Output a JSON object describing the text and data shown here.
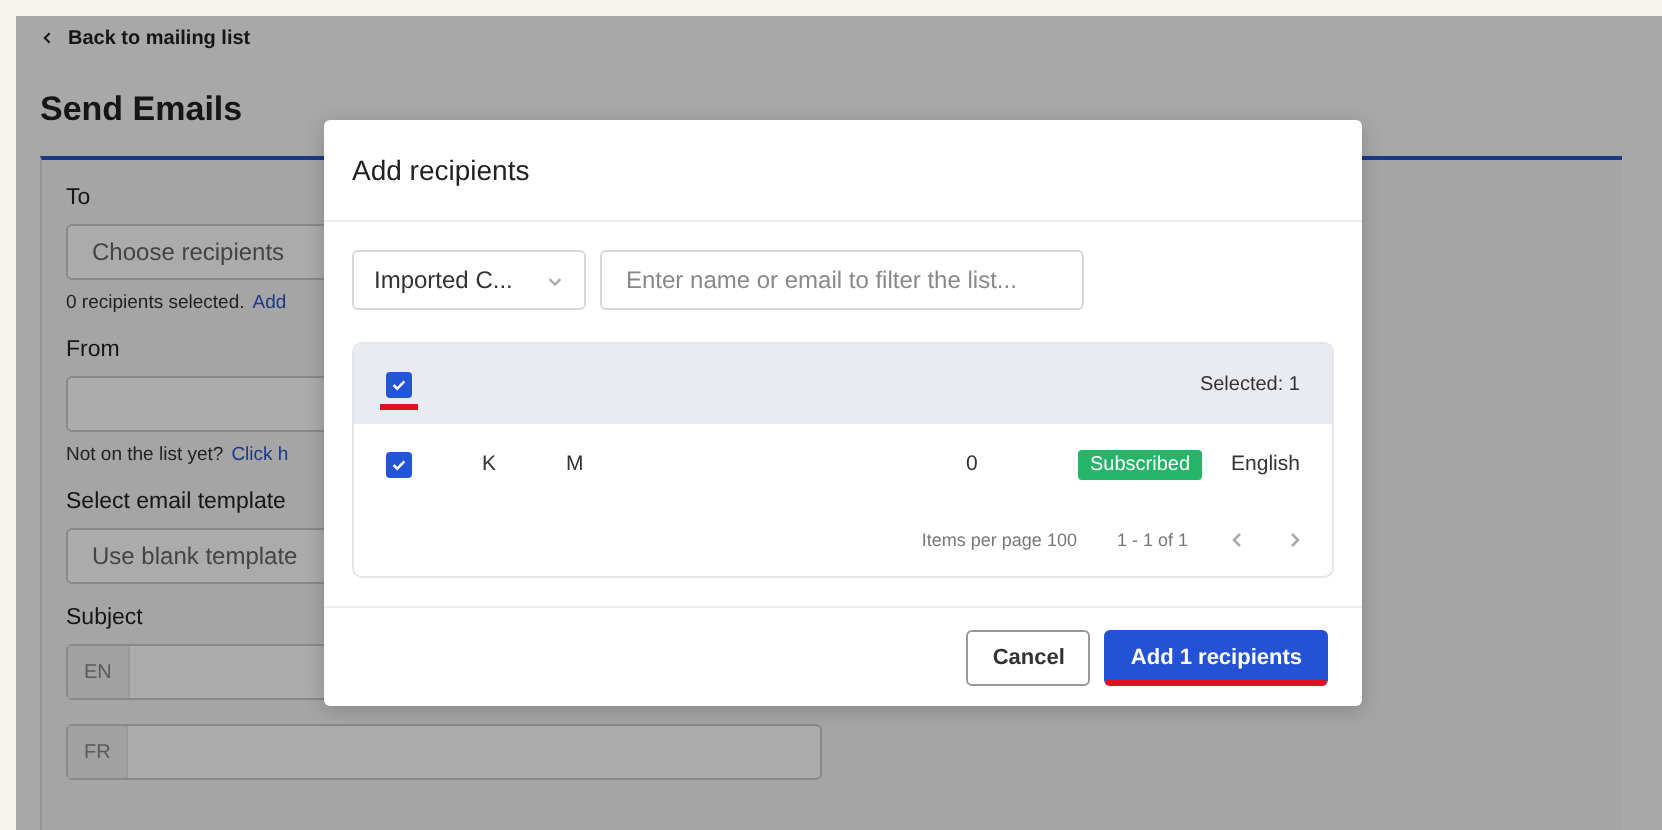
{
  "page": {
    "back_link": "Back to mailing list",
    "title": "Send Emails",
    "form": {
      "to": {
        "label": "To",
        "placeholder": "Choose recipients",
        "note": "0 recipients selected.",
        "note_link": "Add"
      },
      "from": {
        "label": "From",
        "note": "Not on the list yet?",
        "note_link": "Click h"
      },
      "template": {
        "label": "Select email template",
        "value": "Use blank template"
      },
      "subject": {
        "label": "Subject",
        "fields": [
          "EN",
          "FR"
        ]
      }
    }
  },
  "dialog": {
    "title": "Add recipients",
    "list_select": "Imported C...",
    "search": {
      "placeholder": "Enter name or email to filter the list..."
    },
    "table": {
      "header": {
        "checked": true,
        "highlighted": true,
        "selected_count": "Selected: 1"
      },
      "rows": [
        {
          "checked": true,
          "cells": [
            "K",
            "M",
            "0"
          ],
          "status": "Subscribed",
          "language": "English"
        }
      ]
    },
    "pagination": {
      "items_per_page": "Items per page 100",
      "range": "1 - 1 of 1"
    },
    "buttons": [
      {
        "label": "Cancel",
        "kind": "secondary",
        "highlighted": false
      },
      {
        "label": "Add 1 recipients",
        "kind": "primary",
        "highlighted": true
      }
    ]
  }
}
